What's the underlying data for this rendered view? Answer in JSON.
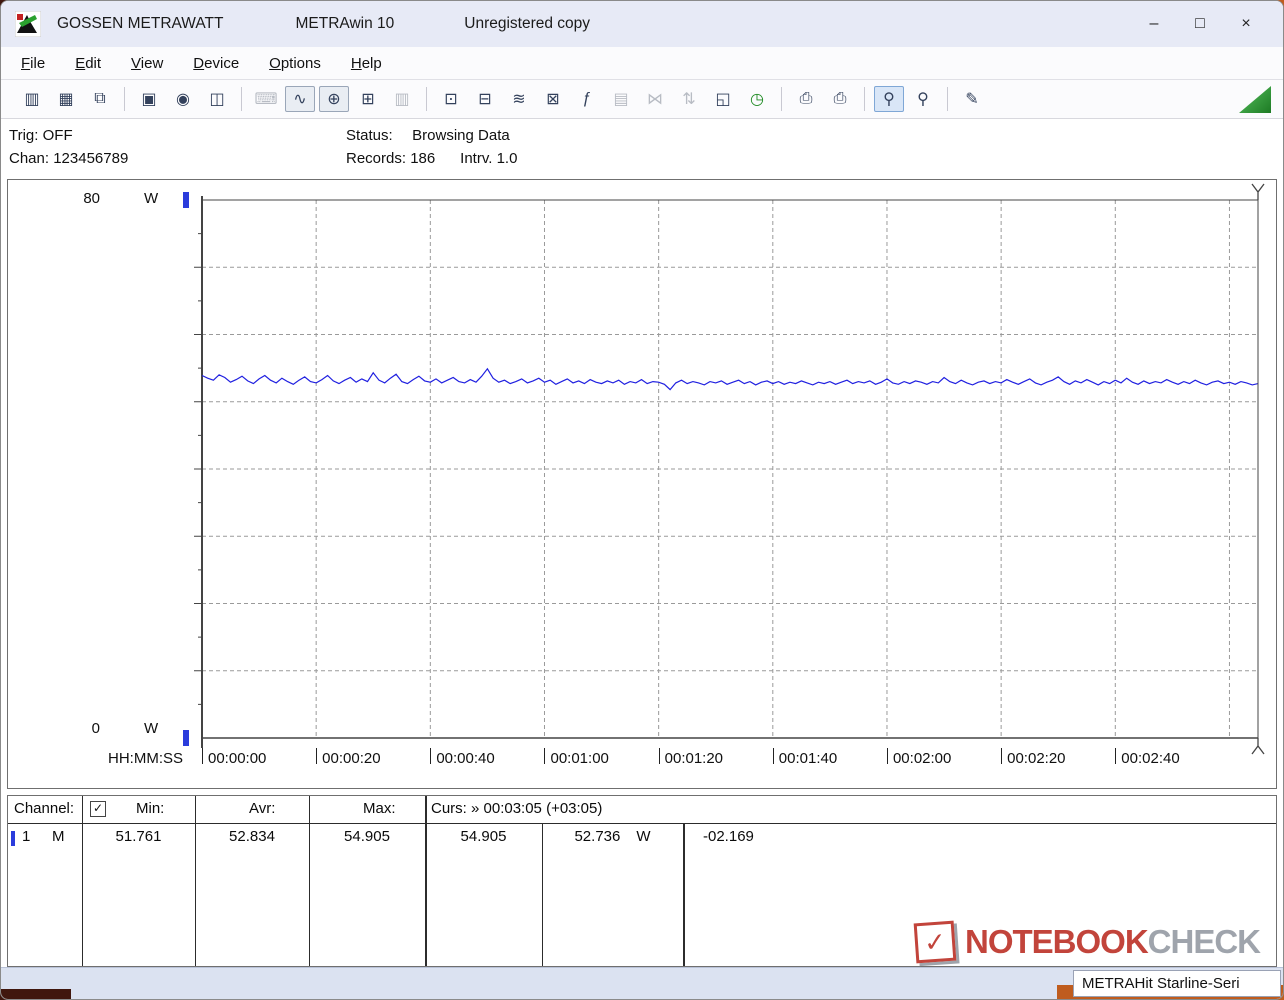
{
  "window": {
    "title_app": "GOSSEN METRAWATT",
    "title_product": "METRAwin 10",
    "title_license": "Unregistered copy",
    "controls": {
      "minimize": "–",
      "maximize": "□",
      "close": "×"
    }
  },
  "menu": {
    "items": [
      {
        "label": "File"
      },
      {
        "label": "Edit"
      },
      {
        "label": "View"
      },
      {
        "label": "Device"
      },
      {
        "label": "Options"
      },
      {
        "label": "Help"
      }
    ]
  },
  "toolbar": {
    "items": [
      {
        "type": "button",
        "name": "open-data",
        "glyph": "▥"
      },
      {
        "type": "button",
        "name": "save-data",
        "glyph": "▦"
      },
      {
        "type": "button",
        "name": "open-file",
        "glyph": "⧉"
      },
      {
        "type": "sep"
      },
      {
        "type": "button",
        "name": "view-window",
        "glyph": "▣"
      },
      {
        "type": "button",
        "name": "record-data",
        "glyph": "◉"
      },
      {
        "type": "button",
        "name": "export-window",
        "glyph": "◫"
      },
      {
        "type": "sep"
      },
      {
        "type": "button",
        "name": "keyboard-entry",
        "glyph": "⌨",
        "disabled": true
      },
      {
        "type": "button",
        "name": "trend-chart-view",
        "glyph": "∿",
        "pressed": true
      },
      {
        "type": "button",
        "name": "cursor-crosshair-view",
        "glyph": "⊕",
        "pressed": true
      },
      {
        "type": "button",
        "name": "table-view",
        "glyph": "⊞"
      },
      {
        "type": "button",
        "name": "histogram-view",
        "glyph": "▥",
        "disabled": true
      },
      {
        "type": "sep"
      },
      {
        "type": "button",
        "name": "device-config",
        "glyph": "⊡"
      },
      {
        "type": "button",
        "name": "device-download",
        "glyph": "⊟"
      },
      {
        "type": "button",
        "name": "device-trend",
        "glyph": "≋"
      },
      {
        "type": "button",
        "name": "device-monitor",
        "glyph": "⊠"
      },
      {
        "type": "button",
        "name": "formula",
        "glyph": "ƒ"
      },
      {
        "type": "button",
        "name": "device-memory",
        "glyph": "▤",
        "disabled": true
      },
      {
        "type": "button",
        "name": "split-curves",
        "glyph": "⋈",
        "disabled": true
      },
      {
        "type": "button",
        "name": "scale-axes",
        "glyph": "⇅",
        "disabled": true
      },
      {
        "type": "button",
        "name": "copy-pages",
        "glyph": "◱"
      },
      {
        "type": "button",
        "name": "timer",
        "glyph": "◷",
        "accent": "green"
      },
      {
        "type": "sep"
      },
      {
        "type": "button",
        "name": "print",
        "glyph": "⎙"
      },
      {
        "type": "button",
        "name": "print-preview",
        "glyph": "⎙"
      },
      {
        "type": "sep"
      },
      {
        "type": "button",
        "name": "zoom-curve",
        "glyph": "⚲",
        "pressed": true,
        "accent": "blue"
      },
      {
        "type": "button",
        "name": "zoom-mode",
        "glyph": "⚲"
      },
      {
        "type": "sep"
      },
      {
        "type": "button",
        "name": "annotation",
        "glyph": "✎"
      }
    ]
  },
  "status_panel": {
    "trig_label": "Trig:",
    "trig_value": "OFF",
    "chan_label": "Chan:",
    "chan_value": "123456789",
    "status_label": "Status:",
    "status_value": "Browsing Data",
    "records_text": "Records: 186",
    "intrv_text": "Intrv. 1.0"
  },
  "chart_data": {
    "type": "line",
    "title": "",
    "xlabel": "HH:MM:SS",
    "ylabel": "W",
    "ylim": [
      0,
      80
    ],
    "y_gridline_step": 10,
    "y_top_label": "80",
    "y_bottom_label": "0",
    "y_unit": "W",
    "x_end_s": 185,
    "x_tick_interval_s": 20,
    "x_tick_labels": [
      "00:00:00",
      "00:00:20",
      "00:00:40",
      "00:01:00",
      "00:01:20",
      "00:01:40",
      "00:02:00",
      "00:02:20",
      "00:02:40"
    ],
    "grid": true,
    "cursor_position": "00:03:05",
    "series": [
      {
        "name": "channel-1-power",
        "unit": "W",
        "color": "#2020e0",
        "interval_s": 1.0,
        "start_s": 0,
        "values": [
          53.9,
          53.5,
          53.2,
          54.0,
          53.6,
          52.9,
          53.3,
          53.8,
          53.1,
          52.7,
          53.4,
          53.9,
          53.2,
          52.8,
          53.5,
          53.0,
          52.6,
          53.2,
          53.7,
          53.0,
          52.8,
          53.3,
          53.9,
          53.1,
          52.7,
          53.2,
          53.6,
          52.9,
          53.4,
          53.0,
          54.3,
          53.2,
          52.8,
          53.5,
          54.1,
          53.0,
          52.7,
          53.3,
          53.8,
          53.1,
          52.9,
          53.4,
          52.8,
          53.2,
          53.6,
          53.0,
          52.8,
          53.3,
          52.9,
          53.8,
          54.9,
          53.5,
          52.9,
          53.2,
          52.7,
          53.0,
          53.4,
          52.8,
          53.1,
          53.5,
          52.9,
          53.2,
          52.6,
          53.0,
          53.4,
          52.8,
          53.1,
          52.7,
          53.3,
          52.9,
          52.7,
          53.1,
          52.8,
          53.2,
          52.6,
          53.0,
          52.8,
          53.3,
          52.7,
          53.0,
          52.9,
          52.6,
          51.8,
          52.8,
          53.2,
          52.7,
          53.0,
          52.8,
          52.5,
          53.0,
          52.8,
          53.1,
          52.6,
          52.9,
          53.2,
          52.7,
          53.0,
          52.5,
          52.9,
          53.1,
          52.7,
          53.0,
          52.6,
          52.9,
          52.7,
          53.1,
          52.8,
          52.5,
          52.9,
          52.7,
          53.0,
          52.6,
          52.9,
          53.2,
          52.7,
          53.0,
          52.8,
          53.1,
          52.6,
          52.9,
          53.4,
          52.8,
          52.6,
          53.0,
          52.7,
          53.1,
          52.9,
          52.6,
          53.0,
          52.8,
          53.6,
          53.0,
          52.7,
          53.2,
          52.8,
          52.5,
          52.9,
          53.1,
          52.7,
          53.0,
          52.8,
          53.3,
          52.9,
          52.6,
          53.0,
          53.4,
          52.8,
          52.5,
          52.9,
          53.2,
          53.7,
          53.0,
          52.6,
          53.1,
          52.8,
          53.3,
          52.9,
          52.5,
          53.0,
          52.7,
          53.2,
          52.8,
          53.5,
          52.9,
          52.6,
          53.1,
          52.7,
          53.0,
          52.8,
          53.3,
          52.9,
          52.6,
          53.0,
          52.7,
          53.2,
          52.8,
          52.5,
          52.9,
          53.1,
          52.7,
          52.9,
          52.6,
          53.0,
          52.8,
          52.5,
          52.7
        ]
      }
    ]
  },
  "table": {
    "header": {
      "channel": "Channel:",
      "checkbox_checked": true,
      "check_glyph": "✓",
      "min": "Min:",
      "avr": "Avr:",
      "max": "Max:",
      "curs": "Curs: » 00:03:05 (+03:05)"
    },
    "row": {
      "channel": "1",
      "mode": "M",
      "min": "51.761",
      "avr": "52.834",
      "max": "54.905",
      "curs_a": "54.905",
      "curs_b": "52.736",
      "unit": "W",
      "delta": "-02.169"
    }
  },
  "watermark": {
    "notebook": "NOTEBOOK",
    "check": "CHECK",
    "check_glyph": "✓"
  },
  "statusbar": {
    "device": "METRAHit Starline-Seri"
  }
}
